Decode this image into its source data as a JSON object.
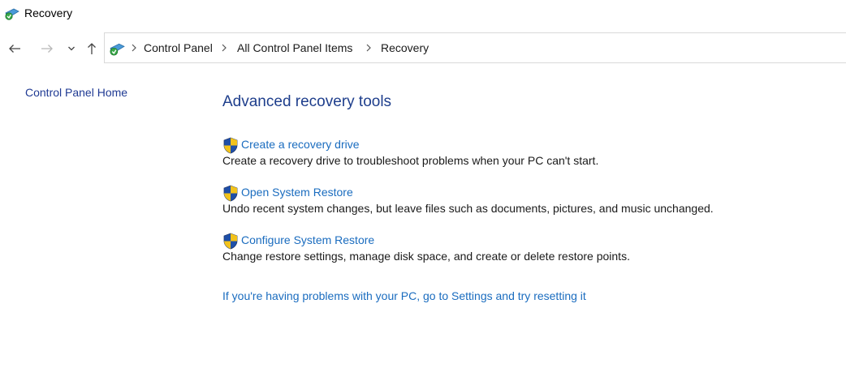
{
  "window": {
    "title": "Recovery"
  },
  "nav": {
    "back_icon": "arrow-left-icon",
    "forward_icon": "arrow-right-icon",
    "recent_icon": "chevron-down-icon",
    "up_icon": "arrow-up-icon"
  },
  "breadcrumb": {
    "items": [
      "Control Panel",
      "All Control Panel Items",
      "Recovery"
    ],
    "separator_icon": "chevron-right-icon"
  },
  "sidebar": {
    "home_link": "Control Panel Home"
  },
  "main": {
    "heading": "Advanced recovery tools",
    "tools": [
      {
        "label": "Create a recovery drive",
        "description": "Create a recovery drive to troubleshoot problems when your PC can't start.",
        "icon": "uac-shield-icon"
      },
      {
        "label": "Open System Restore",
        "description": "Undo recent system changes, but leave files such as documents, pictures, and music unchanged.",
        "icon": "uac-shield-icon"
      },
      {
        "label": "Configure System Restore",
        "description": "Change restore settings, manage disk space, and create or delete restore points.",
        "icon": "uac-shield-icon"
      }
    ],
    "reset_link": "If you're having problems with your PC, go to Settings and try resetting it"
  },
  "colors": {
    "link": "#1a6cbf",
    "heading": "#1e3e8c",
    "sidebar_link": "#1f3a93"
  }
}
